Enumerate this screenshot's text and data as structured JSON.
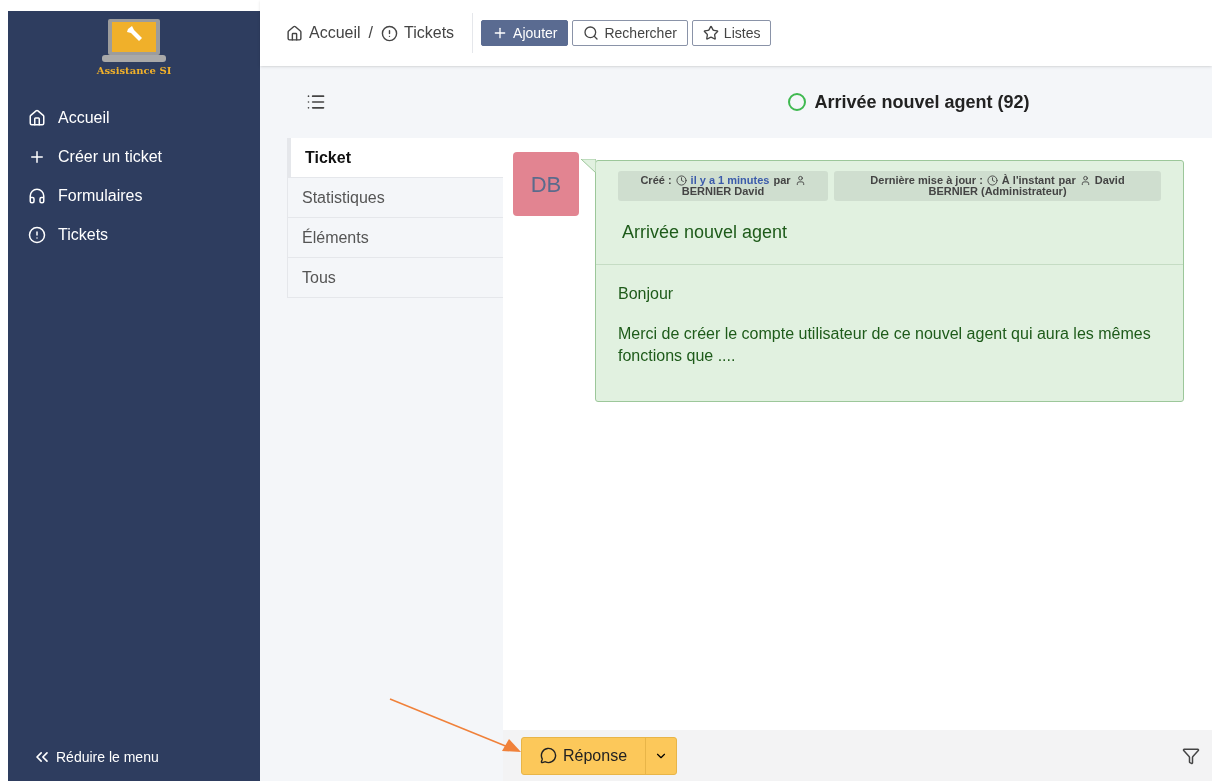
{
  "logo": {
    "text": "Assistance SI"
  },
  "sidebar": {
    "items": [
      {
        "label": "Accueil"
      },
      {
        "label": "Créer un ticket"
      },
      {
        "label": "Formulaires"
      },
      {
        "label": "Tickets"
      }
    ],
    "collapse": "Réduire le menu"
  },
  "breadcrumb": [
    {
      "label": "Accueil"
    },
    {
      "label": "Tickets"
    }
  ],
  "breadcrumb_separator": "/",
  "toolbar": [
    {
      "label": "Ajouter",
      "primary": true
    },
    {
      "label": "Rechercher",
      "primary": false
    },
    {
      "label": "Listes",
      "primary": false
    }
  ],
  "ticket_title": "Arrivée nouvel agent (92)",
  "tabs": [
    {
      "label": "Ticket",
      "selected": true
    },
    {
      "label": "Statistiques",
      "selected": false
    },
    {
      "label": "Éléments",
      "selected": false
    },
    {
      "label": "Tous",
      "selected": false
    }
  ],
  "message": {
    "avatar": "DB",
    "meta": [
      {
        "label": "Créé :",
        "time": "il y a 1 minutes",
        "time_link": true,
        "by": "par",
        "author_rest": "BERNIER David"
      },
      {
        "label": "Dernière mise à jour :",
        "time": "À l'instant",
        "time_link": false,
        "by": "par",
        "author_first": "David",
        "author_rest": "BERNIER (Administrateur)"
      }
    ],
    "title": "Arrivée nouvel agent",
    "paragraphs": [
      "Bonjour",
      "Merci de créer le compte utilisateur de ce nouvel agent qui aura les mêmes fonctions que ...."
    ]
  },
  "reply_button": "Réponse"
}
